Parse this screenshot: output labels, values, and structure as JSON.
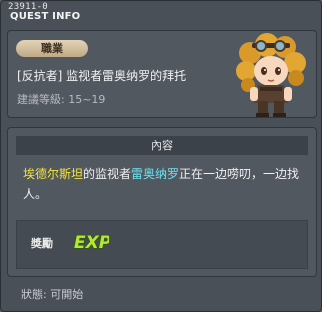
{
  "header": {
    "quest_id": "23911-0",
    "title": "QUEST INFO"
  },
  "quest": {
    "job_label": "職業",
    "title": "[反抗者] 监视者雷奥纳罗的拜托",
    "level_range": "建議等級: 15~19"
  },
  "content": {
    "header": "內容",
    "desc_npc1": "埃德尔斯坦",
    "desc_part1": "的监视者",
    "desc_npc2": "雷奥纳罗",
    "desc_part2": "正在一边唠叨，一边找人。",
    "npc1_color": "#f5e53a",
    "npc2_color": "#69e3f0"
  },
  "reward": {
    "label": "獎勵",
    "icon": "exp-icon",
    "icon_text": "EXP"
  },
  "status": {
    "text": "狀態: 可開始"
  }
}
